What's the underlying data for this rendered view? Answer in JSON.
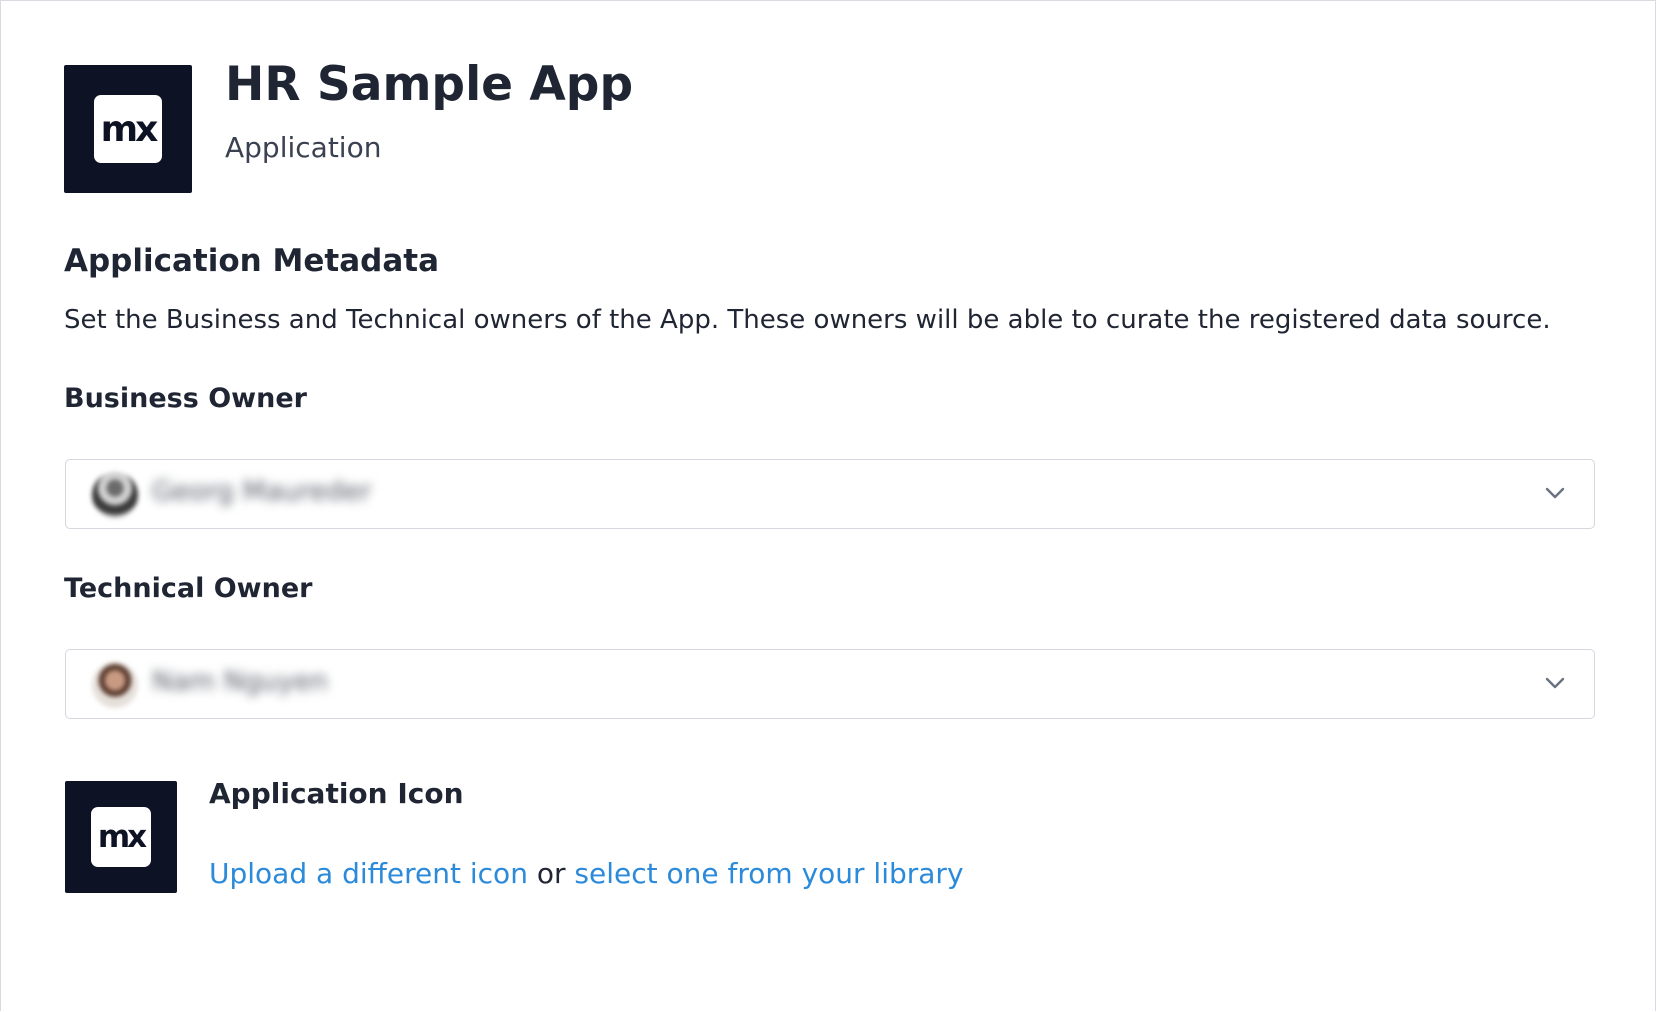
{
  "header": {
    "logo_text": "mx",
    "title": "HR Sample App",
    "subtitle": "Application"
  },
  "metadata": {
    "title": "Application Metadata",
    "description": "Set the Business and Technical owners of the App. These owners will be able to curate the registered data source."
  },
  "business_owner": {
    "label": "Business Owner",
    "value": "Georg Maureder",
    "avatar_icon": "user-avatar-icon"
  },
  "technical_owner": {
    "label": "Technical Owner",
    "value": "Nam Nguyen",
    "avatar_icon": "user-avatar-icon"
  },
  "application_icon": {
    "logo_text": "mx",
    "title": "Application Icon",
    "upload_link": "Upload a different icon",
    "separator": "or",
    "library_link": "select one from your library"
  },
  "colors": {
    "logo_background": "#0d1324",
    "link": "#2b8ad9",
    "text": "#1f2533"
  }
}
